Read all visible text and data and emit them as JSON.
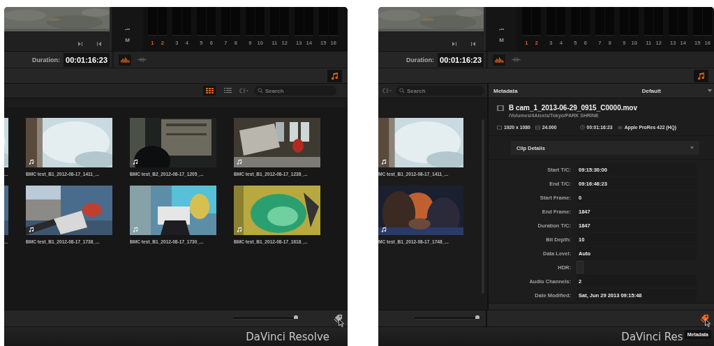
{
  "panels": [
    {
      "meter": {
        "floor_label": "-∞",
        "mute_label": "M",
        "channels": [
          {
            "label": "1",
            "on": true
          },
          {
            "label": "2",
            "on": true
          },
          {
            "label": "3",
            "on": false
          },
          {
            "label": "4",
            "on": false
          },
          {
            "label": "5",
            "on": false
          },
          {
            "label": "6",
            "on": false
          },
          {
            "label": "7",
            "on": false
          },
          {
            "label": "8",
            "on": false
          },
          {
            "label": "9",
            "on": false
          },
          {
            "label": "10",
            "on": false
          },
          {
            "label": "11",
            "on": false
          },
          {
            "label": "12",
            "on": false
          },
          {
            "label": "13",
            "on": false
          },
          {
            "label": "14",
            "on": false
          },
          {
            "label": "15",
            "on": false
          },
          {
            "label": "16",
            "on": false
          }
        ]
      },
      "duration": {
        "label": "Duration:",
        "value": "00:01:16:23"
      },
      "audio_views": [
        {
          "kind": "meters",
          "selected": true
        },
        {
          "kind": "waveform",
          "selected": false
        }
      ],
      "audio_button": {
        "on": true
      },
      "media_pool": {
        "view_modes": [
          {
            "kind": "grid",
            "selected": true
          },
          {
            "kind": "list",
            "selected": false
          }
        ],
        "search": {
          "placeholder": "Search"
        },
        "rows": [
          {
            "clips": [
              {
                "name": "...",
                "partial": true,
                "has_audio": false
              },
              {
                "name": "BMC test_B1_2012-08-17_1411_...",
                "partial": false,
                "has_audio": true
              },
              {
                "name": "BMC test_B2_2012-08-17_1205_...",
                "partial": false,
                "has_audio": true
              },
              {
                "name": "BMC test_B1_2012-08-17_1238_...",
                "partial": false,
                "has_audio": true
              }
            ]
          },
          {
            "clips": [
              {
                "name": "...",
                "partial": true,
                "has_audio": false
              },
              {
                "name": "BMC test_B1_2012-08-17_1738_...",
                "partial": false,
                "has_audio": true
              },
              {
                "name": "BMC test_B1_2012-08-17_1730_...",
                "partial": false,
                "has_audio": true
              },
              {
                "name": "BMC test_B1_2012-08-17_1618_...",
                "partial": false,
                "has_audio": true
              }
            ]
          }
        ],
        "zoom": {
          "level": 0.97
        }
      },
      "metadata_button": {
        "on": false
      },
      "footer": {
        "brand": "DaVinci Resolve"
      }
    },
    {
      "meter": {
        "floor_label": "-∞",
        "mute_label": "M",
        "channels": [
          {
            "label": "1",
            "on": true
          },
          {
            "label": "2",
            "on": true
          },
          {
            "label": "3",
            "on": false
          },
          {
            "label": "4",
            "on": false
          },
          {
            "label": "5",
            "on": false
          },
          {
            "label": "6",
            "on": false
          },
          {
            "label": "7",
            "on": false
          },
          {
            "label": "8",
            "on": false
          },
          {
            "label": "9",
            "on": false
          },
          {
            "label": "10",
            "on": false
          },
          {
            "label": "11",
            "on": false
          },
          {
            "label": "12",
            "on": false
          },
          {
            "label": "13",
            "on": false
          },
          {
            "label": "14",
            "on": false
          },
          {
            "label": "15",
            "on": false
          },
          {
            "label": "16",
            "on": false
          }
        ]
      },
      "duration": {
        "label": "Duration:",
        "value": "00:01:16:23"
      },
      "audio_views": [
        {
          "kind": "meters",
          "selected": true
        },
        {
          "kind": "waveform",
          "selected": false
        }
      ],
      "audio_button": {
        "on": true
      },
      "media_pool": {
        "search": {
          "placeholder": "Search"
        },
        "rows": [
          {
            "clips": [
              {
                "name": "MC test_B1_2012-08-17_1411_...",
                "partial": false,
                "has_audio": true
              }
            ]
          },
          {
            "clips": [
              {
                "name": "MC test_B1_2012-08-17_1748_...",
                "partial": false,
                "has_audio": true
              }
            ]
          }
        ],
        "zoom": {
          "level": 0.97
        }
      },
      "metadata": {
        "title": "Metadata",
        "preset": "Default",
        "file_name": "B cam_1_2013-06-29_0915_C0000.mov",
        "path": "/Volumes/4Alexis/Tokyo/PARK SHRINE",
        "resolution": "1920 x 1080",
        "frame_rate": "24.000",
        "duration": "00:01:16:23",
        "codec": "Apple ProRes 422 (HQ)",
        "group": "Clip Details",
        "fields": [
          {
            "label": "Start T/C:",
            "value": "09:15:30:00"
          },
          {
            "label": "End T/C:",
            "value": "09:16:46:23"
          },
          {
            "label": "Start Frame:",
            "value": "0"
          },
          {
            "label": "End Frame:",
            "value": "1847"
          },
          {
            "label": "Duration T/C:",
            "value": "1847"
          },
          {
            "label": "Bit Depth:",
            "value": "10"
          },
          {
            "label": "Data Level:",
            "value": "Auto"
          },
          {
            "label": "HDR:"
          },
          {
            "label": "Audio Channels:",
            "value": "2"
          },
          {
            "label": "Date Modified:",
            "value": "Sat, Jun 29 2013 09:15:48"
          }
        ]
      },
      "metadata_button": {
        "on": true
      },
      "tooltip": "Metadata",
      "footer": {
        "brand": "DaVinci Res"
      }
    }
  ]
}
